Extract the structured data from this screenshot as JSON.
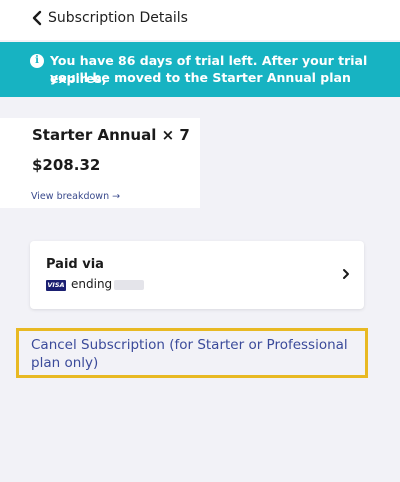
{
  "header": {
    "title": "Subscription Details"
  },
  "banner": {
    "line1": "You have 86 days of trial left. After your trial expires,",
    "line2": "you'll be moved to the Starter Annual plan"
  },
  "plan": {
    "name": "Starter Annual × 7",
    "price": "$208.32",
    "breakdown_link": "View breakdown →"
  },
  "payment": {
    "label": "Paid via",
    "card_brand": "VISA",
    "ending_text": "ending"
  },
  "cancel": {
    "label": "Cancel Subscription (for Starter or Professional plan only)"
  },
  "colors": {
    "banner": "#17b3c2",
    "link": "#3a4a9a",
    "highlight": "#e8b923"
  }
}
